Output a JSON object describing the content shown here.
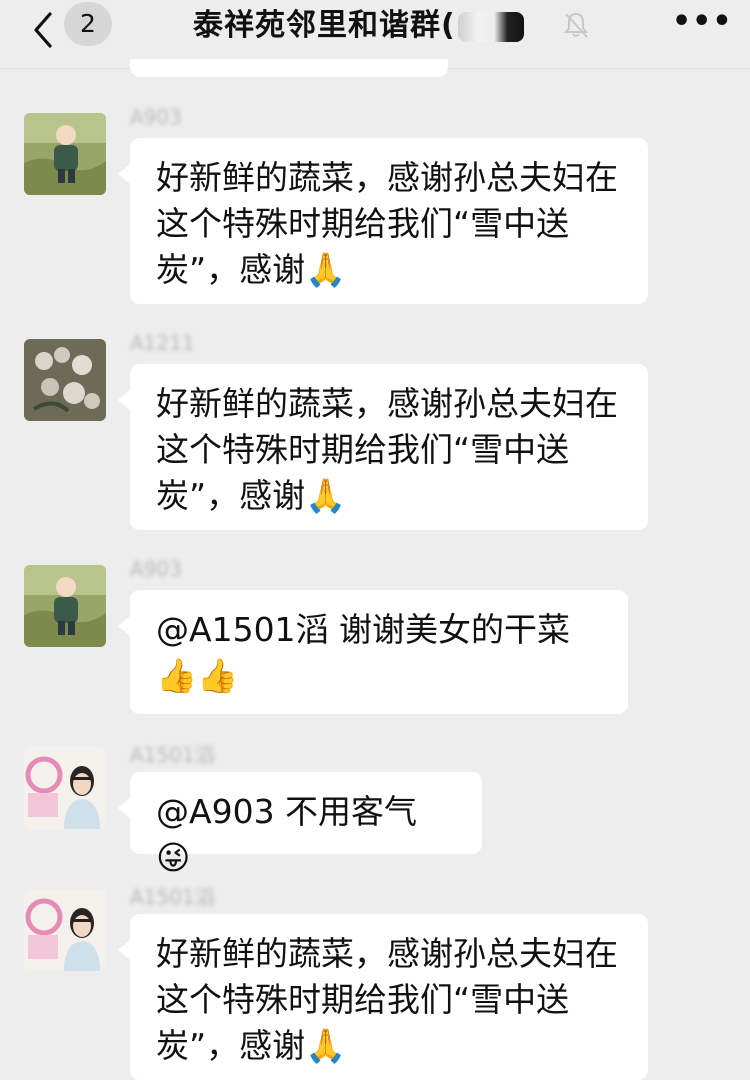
{
  "header": {
    "unread_count": "2",
    "title": "泰祥苑邻里和谐群("
  },
  "messages": [
    {
      "sender": "A903",
      "text": "好新鲜的蔬菜，感谢孙总夫妇在这个特殊时期给我们“雪中送炭”，感谢",
      "emoji": "🙏"
    },
    {
      "sender": "A1211",
      "text": "好新鲜的蔬菜，感谢孙总夫妇在这个特殊时期给我们“雪中送炭”，感谢",
      "emoji": "🙏"
    },
    {
      "sender": "A903",
      "text": "@A1501滔 谢谢美女的干菜",
      "emoji": "👍👍"
    },
    {
      "sender": "A1501滔",
      "text": "@A903 不用客气",
      "emoji": "😜"
    },
    {
      "sender": "A1501滔",
      "text": "好新鲜的蔬菜，感谢孙总夫妇在这个特殊时期给我们“雪中送炭”，感谢",
      "emoji": "🙏"
    }
  ]
}
